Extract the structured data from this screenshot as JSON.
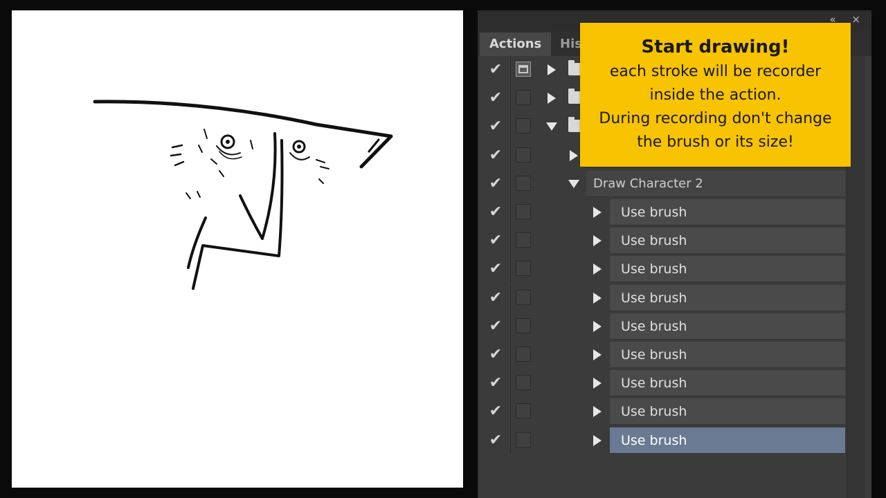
{
  "panel": {
    "tabs": [
      {
        "label": "Actions",
        "active": true
      },
      {
        "label": "His",
        "active": false
      }
    ],
    "controls": {
      "collapse": "«",
      "close": "×"
    }
  },
  "actions": {
    "sets": [
      {
        "checked": true,
        "dialog_on": true,
        "expanded": false,
        "type": "set"
      },
      {
        "checked": true,
        "dialog_on": false,
        "expanded": false,
        "type": "set"
      },
      {
        "checked": true,
        "dialog_on": false,
        "expanded": true,
        "type": "set"
      }
    ],
    "action_collapsed": {
      "checked": true
    },
    "action_expanded": {
      "checked": true,
      "label": "Draw Character 2"
    },
    "steps_label": "Use brush",
    "steps_count": 9,
    "selected_step": 9
  },
  "callout": {
    "title": "Start drawing!",
    "lines": [
      "each stroke will be recorder",
      "inside the action.",
      "During recording don't change",
      "the brush or its size!"
    ]
  },
  "icons": {
    "check": "checkmark-icon",
    "dialog": "dialog-toggle-icon",
    "folder": "folder-icon",
    "expand": "triangle-right-icon",
    "collapse": "triangle-down-icon"
  },
  "colors": {
    "callout_bg": "#f8c300",
    "selection": "#6b7a93",
    "panel_bg": "#3b3b3b"
  }
}
